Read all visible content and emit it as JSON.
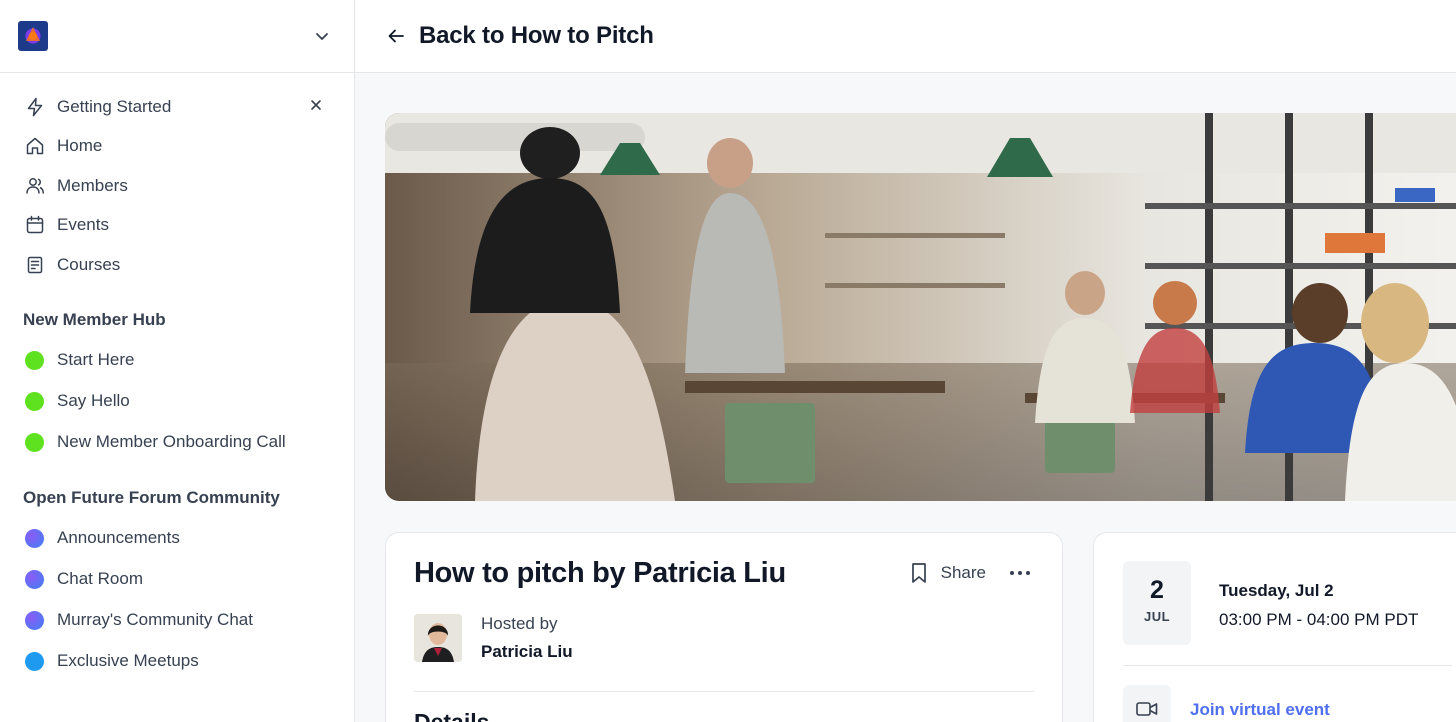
{
  "sidebar": {
    "nav": [
      {
        "label": "Getting Started",
        "icon": "lightning-icon"
      },
      {
        "label": "Home",
        "icon": "home-icon"
      },
      {
        "label": "Members",
        "icon": "members-icon"
      },
      {
        "label": "Events",
        "icon": "calendar-icon"
      },
      {
        "label": "Courses",
        "icon": "courses-icon"
      }
    ],
    "sections": [
      {
        "title": "New Member Hub",
        "items": [
          {
            "label": "Start Here",
            "color": "#5ee11f"
          },
          {
            "label": "Say Hello",
            "color": "#5ee11f"
          },
          {
            "label": "New Member Onboarding Call",
            "color": "#5ee11f"
          }
        ]
      },
      {
        "title": "Open Future Forum Community",
        "items": [
          {
            "label": "Announcements",
            "color": "#6d5ef5"
          },
          {
            "label": "Chat Room",
            "color": "#6d5ef5"
          },
          {
            "label": "Murray's Community Chat",
            "color": "#6d5ef5"
          },
          {
            "label": "Exclusive Meetups",
            "color": "#2196f3"
          }
        ]
      }
    ]
  },
  "header": {
    "back_label": "Back to How to Pitch"
  },
  "event": {
    "title": "How to pitch by Patricia Liu",
    "share_label": "Share",
    "hosted_by_label": "Hosted by",
    "host_name": "Patricia Liu",
    "details_heading": "Details"
  },
  "schedule": {
    "day": "2",
    "month": "JUL",
    "date_text": "Tuesday, Jul 2",
    "time_text": "03:00 PM - 04:00 PM PDT",
    "join_label": "Join virtual event"
  }
}
